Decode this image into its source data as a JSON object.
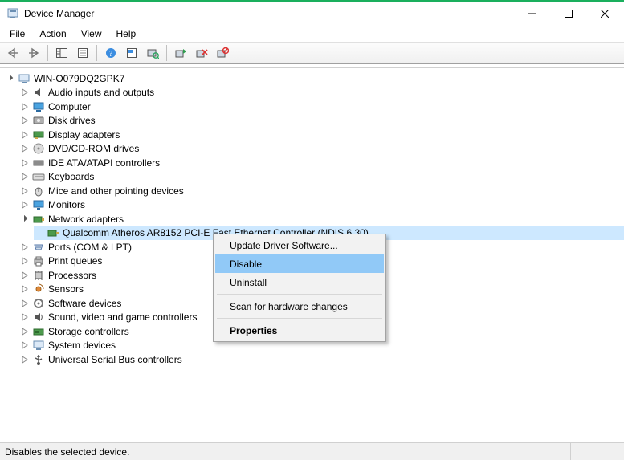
{
  "window": {
    "title": "Device Manager"
  },
  "menu": {
    "file": "File",
    "action": "Action",
    "view": "View",
    "help": "Help"
  },
  "tree": {
    "root": "WIN-O079DQ2GPK7",
    "nodes": {
      "audio": "Audio inputs and outputs",
      "computer": "Computer",
      "disk": "Disk drives",
      "display": "Display adapters",
      "dvd": "DVD/CD-ROM drives",
      "ide": "IDE ATA/ATAPI controllers",
      "keyboards": "Keyboards",
      "mice": "Mice and other pointing devices",
      "monitors": "Monitors",
      "network": "Network adapters",
      "network_child": "Qualcomm Atheros AR8152 PCI-E Fast Ethernet Controller (NDIS 6.30)",
      "ports": "Ports (COM & LPT)",
      "printq": "Print queues",
      "processors": "Processors",
      "sensors": "Sensors",
      "software": "Software devices",
      "sound": "Sound, video and game controllers",
      "storage": "Storage controllers",
      "system": "System devices",
      "usb": "Universal Serial Bus controllers"
    }
  },
  "context_menu": {
    "update": "Update Driver Software...",
    "disable": "Disable",
    "uninstall": "Uninstall",
    "scan": "Scan for hardware changes",
    "properties": "Properties"
  },
  "status": {
    "text": "Disables the selected device."
  }
}
